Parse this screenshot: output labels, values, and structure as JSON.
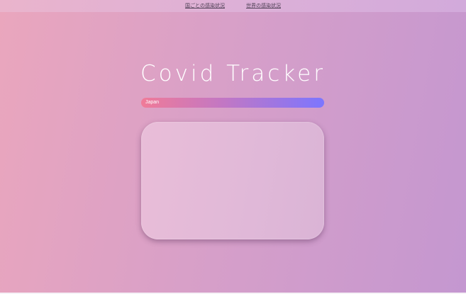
{
  "nav": {
    "links": [
      {
        "label": "国ごとの感染状況"
      },
      {
        "label": "世界の感染状況"
      }
    ]
  },
  "title": "Covid Tracker",
  "country_select": {
    "value": "Japan"
  },
  "colors": {
    "background_left": "#eaa6bd",
    "background_right": "#c497d0",
    "select_gradient_start": "#f07b98",
    "select_gradient_end": "#7c76ff",
    "card": "#e2b9d8",
    "title_text": "#ffffff"
  }
}
